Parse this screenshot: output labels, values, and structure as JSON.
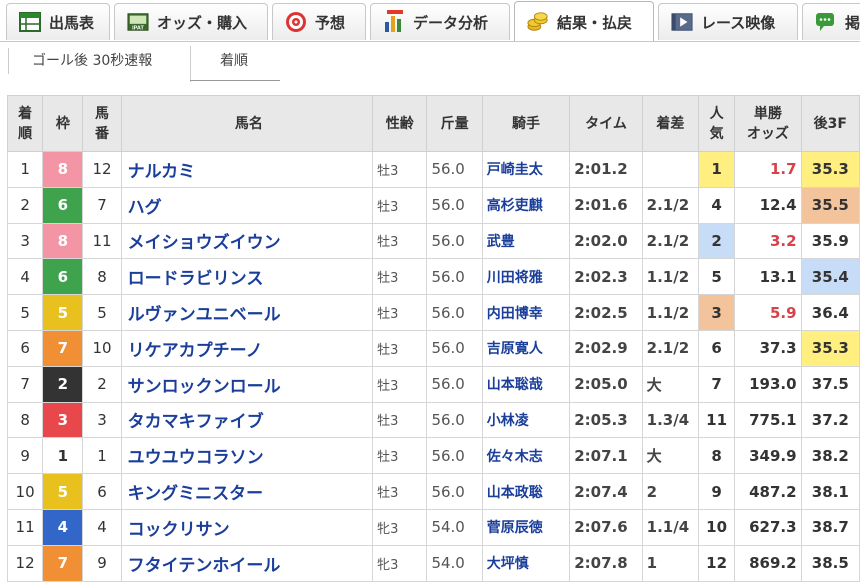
{
  "nav": {
    "tabs": [
      {
        "label": "出馬表",
        "icon": "table-icon"
      },
      {
        "label": "オッズ・購入",
        "icon": "ipat-icon"
      },
      {
        "label": "予想",
        "icon": "target-icon"
      },
      {
        "label": "データ分析",
        "icon": "bar-chart-icon"
      },
      {
        "label": "結果・払戻",
        "icon": "coins-icon",
        "active": true
      },
      {
        "label": "レース映像",
        "icon": "video-icon"
      },
      {
        "label": "掲",
        "icon": "chat-icon"
      }
    ],
    "ipat_badge": "IPAT"
  },
  "subtabs": {
    "goal": "ゴール後 30秒速報",
    "order": "着順"
  },
  "table": {
    "headers": {
      "rank": [
        "着",
        "順"
      ],
      "waku": "枠",
      "uma": [
        "馬",
        "番"
      ],
      "name": "馬名",
      "sex": "性齢",
      "kin": "斤量",
      "jockey": "騎手",
      "time": "タイム",
      "diff": "着差",
      "pop": [
        "人",
        "気"
      ],
      "odds": [
        "単勝",
        "オッズ"
      ],
      "last3f": "後3F"
    },
    "rows": [
      {
        "rank": "1",
        "waku": "8",
        "uma": "12",
        "name": "ナルカミ",
        "sex": "牡3",
        "kin": "56.0",
        "jockey": "戸崎圭太",
        "time": "2:01.2",
        "diff": "",
        "pop": "1",
        "odds": "1.7",
        "last3f": "35.3"
      },
      {
        "rank": "2",
        "waku": "6",
        "uma": "7",
        "name": "ハグ",
        "sex": "牡3",
        "kin": "56.0",
        "jockey": "高杉吏麒",
        "time": "2:01.6",
        "diff": "2.1/2",
        "pop": "4",
        "odds": "12.4",
        "last3f": "35.5"
      },
      {
        "rank": "3",
        "waku": "8",
        "uma": "11",
        "name": "メイショウズイウン",
        "sex": "牡3",
        "kin": "56.0",
        "jockey": "武豊",
        "time": "2:02.0",
        "diff": "2.1/2",
        "pop": "2",
        "odds": "3.2",
        "last3f": "35.9"
      },
      {
        "rank": "4",
        "waku": "6",
        "uma": "8",
        "name": "ロードラビリンス",
        "sex": "牡3",
        "kin": "56.0",
        "jockey": "川田将雅",
        "time": "2:02.3",
        "diff": "1.1/2",
        "pop": "5",
        "odds": "13.1",
        "last3f": "35.4"
      },
      {
        "rank": "5",
        "waku": "5",
        "uma": "5",
        "name": "ルヴァンユニベール",
        "sex": "牡3",
        "kin": "56.0",
        "jockey": "内田博幸",
        "time": "2:02.5",
        "diff": "1.1/2",
        "pop": "3",
        "odds": "5.9",
        "last3f": "36.4"
      },
      {
        "rank": "6",
        "waku": "7",
        "uma": "10",
        "name": "リケアカプチーノ",
        "sex": "牡3",
        "kin": "56.0",
        "jockey": "吉原寛人",
        "time": "2:02.9",
        "diff": "2.1/2",
        "pop": "6",
        "odds": "37.3",
        "last3f": "35.3"
      },
      {
        "rank": "7",
        "waku": "2",
        "uma": "2",
        "name": "サンロックンロール",
        "sex": "牡3",
        "kin": "56.0",
        "jockey": "山本聡哉",
        "time": "2:05.0",
        "diff": "大",
        "pop": "7",
        "odds": "193.0",
        "last3f": "37.5"
      },
      {
        "rank": "8",
        "waku": "3",
        "uma": "3",
        "name": "タカマキファイブ",
        "sex": "牡3",
        "kin": "56.0",
        "jockey": "小林凌",
        "time": "2:05.3",
        "diff": "1.3/4",
        "pop": "11",
        "odds": "775.1",
        "last3f": "37.2"
      },
      {
        "rank": "9",
        "waku": "1",
        "uma": "1",
        "name": "ユウユウコラソン",
        "sex": "牡3",
        "kin": "56.0",
        "jockey": "佐々木志",
        "time": "2:07.1",
        "diff": "大",
        "pop": "8",
        "odds": "349.9",
        "last3f": "38.2"
      },
      {
        "rank": "10",
        "waku": "5",
        "uma": "6",
        "name": "キングミニスター",
        "sex": "牡3",
        "kin": "56.0",
        "jockey": "山本政聡",
        "time": "2:07.4",
        "diff": "2",
        "pop": "9",
        "odds": "487.2",
        "last3f": "38.1"
      },
      {
        "rank": "11",
        "waku": "4",
        "uma": "4",
        "name": "コックリサン",
        "sex": "牝3",
        "kin": "54.0",
        "jockey": "菅原辰徳",
        "time": "2:07.6",
        "diff": "1.1/4",
        "pop": "10",
        "odds": "627.3",
        "last3f": "38.7"
      },
      {
        "rank": "12",
        "waku": "7",
        "uma": "9",
        "name": "フタイテンホイール",
        "sex": "牝3",
        "kin": "54.0",
        "jockey": "大坪慎",
        "time": "2:07.8",
        "diff": "1",
        "pop": "12",
        "odds": "869.2",
        "last3f": "38.5"
      }
    ],
    "last3f_rank": {
      "0": 1,
      "5": 1,
      "3": 2,
      "1": 3
    },
    "colors": {
      "pop1": "#ffef80",
      "pop2": "#c7dcf7",
      "pop3": "#f3c49c",
      "odds_red": "#d9414a",
      "link": "#1a3e9a"
    }
  }
}
